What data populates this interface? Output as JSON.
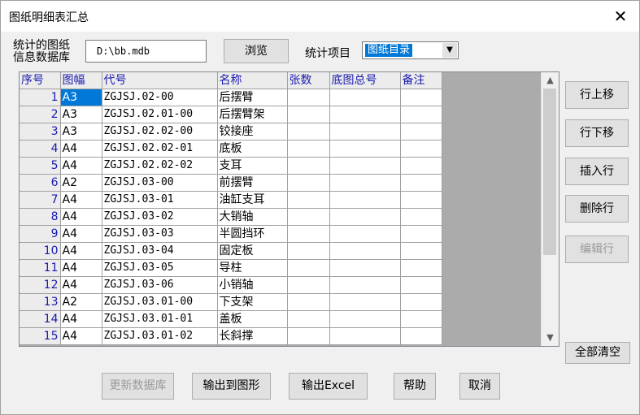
{
  "window": {
    "title": "图纸明细表汇总",
    "close_glyph": "✕"
  },
  "db": {
    "label_line1": "统计的图纸",
    "label_line2": "信息数据库",
    "path": "D:\\bb.mdb",
    "browse_label": "浏览"
  },
  "stat": {
    "label": "统计项目",
    "selected": "图纸目录"
  },
  "table": {
    "columns": [
      "序号",
      "图幅",
      "代号",
      "名称",
      "张数",
      "底图总号",
      "备注"
    ],
    "rows": [
      [
        "1",
        "A3",
        "ZGJSJ.02-00",
        "后摆臂",
        "",
        "",
        ""
      ],
      [
        "2",
        "A3",
        "ZGJSJ.02.01-00",
        "后摆臂架",
        "",
        "",
        ""
      ],
      [
        "3",
        "A3",
        "ZGJSJ.02.02-00",
        "铰接座",
        "",
        "",
        ""
      ],
      [
        "4",
        "A4",
        "ZGJSJ.02.02-01",
        "底板",
        "",
        "",
        ""
      ],
      [
        "5",
        "A4",
        "ZGJSJ.02.02-02",
        "支耳",
        "",
        "",
        ""
      ],
      [
        "6",
        "A2",
        "ZGJSJ.03-00",
        "前摆臂",
        "",
        "",
        ""
      ],
      [
        "7",
        "A4",
        "ZGJSJ.03-01",
        "油缸支耳",
        "",
        "",
        ""
      ],
      [
        "8",
        "A4",
        "ZGJSJ.03-02",
        "大销轴",
        "",
        "",
        ""
      ],
      [
        "9",
        "A4",
        "ZGJSJ.03-03",
        "半圆挡环",
        "",
        "",
        ""
      ],
      [
        "10",
        "A4",
        "ZGJSJ.03-04",
        "固定板",
        "",
        "",
        ""
      ],
      [
        "11",
        "A4",
        "ZGJSJ.03-05",
        "导柱",
        "",
        "",
        ""
      ],
      [
        "12",
        "A4",
        "ZGJSJ.03-06",
        "小销轴",
        "",
        "",
        ""
      ],
      [
        "13",
        "A2",
        "ZGJSJ.03.01-00",
        "下支架",
        "",
        "",
        ""
      ],
      [
        "14",
        "A4",
        "ZGJSJ.03.01-01",
        "盖板",
        "",
        "",
        ""
      ],
      [
        "15",
        "A4",
        "ZGJSJ.03.01-02",
        "长斜撑",
        "",
        "",
        ""
      ]
    ],
    "selected_row": 1,
    "scroll_up": "▲",
    "scroll_down": "▼"
  },
  "side_buttons": {
    "move_up": "行上移",
    "move_down": "行下移",
    "insert": "插入行",
    "delete": "删除行",
    "edit": "编辑行",
    "clear_all": "全部清空"
  },
  "bottom_buttons": {
    "update_db": "更新数据库",
    "export_drawing": "输出到图形",
    "export_excel": "输出Excel",
    "help": "帮助",
    "cancel": "取消"
  }
}
